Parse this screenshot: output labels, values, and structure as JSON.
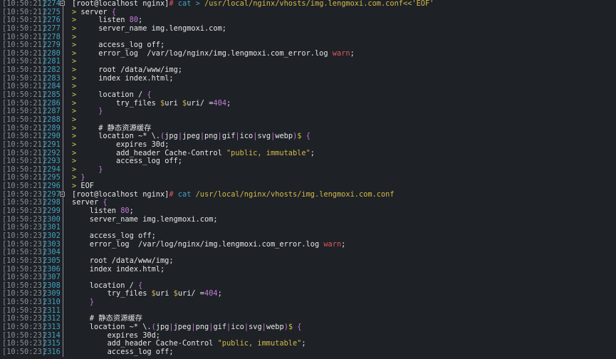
{
  "terminal": {
    "lines": [
      {
        "ts": "[10:50:21]",
        "ln": "2274",
        "fold": true,
        "parts": [
          {
            "t": "[root@localhost nginx]",
            "c": "pr"
          },
          {
            "t": "# ",
            "c": "hash"
          },
          {
            "t": "cat ",
            "c": "cmd"
          },
          {
            "t": "> ",
            "c": "cmd"
          },
          {
            "t": "/usr/local/nginx/vhosts/img.lengmoxi.com.conf<<'EOF'",
            "c": "path"
          }
        ]
      },
      {
        "ts": "[10:50:21]",
        "ln": "2275",
        "parts": [
          {
            "t": "> ",
            "c": "p"
          },
          {
            "t": "server ",
            "c": ""
          },
          {
            "t": "{",
            "c": "br"
          }
        ]
      },
      {
        "ts": "[10:50:21]",
        "ln": "2276",
        "parts": [
          {
            "t": ">     ",
            "c": "p"
          },
          {
            "t": "listen ",
            "c": ""
          },
          {
            "t": "80",
            "c": "num"
          },
          {
            "t": ";",
            "c": ""
          }
        ]
      },
      {
        "ts": "[10:50:21]",
        "ln": "2277",
        "parts": [
          {
            "t": ">     ",
            "c": "p"
          },
          {
            "t": "server_name img.lengmoxi.com;",
            "c": ""
          }
        ]
      },
      {
        "ts": "[10:50:21]",
        "ln": "2278",
        "parts": [
          {
            "t": ">",
            "c": "p"
          }
        ]
      },
      {
        "ts": "[10:50:21]",
        "ln": "2279",
        "parts": [
          {
            "t": ">     ",
            "c": "p"
          },
          {
            "t": "access_log off;",
            "c": ""
          }
        ]
      },
      {
        "ts": "[10:50:21]",
        "ln": "2280",
        "parts": [
          {
            "t": ">     ",
            "c": "p"
          },
          {
            "t": "error_log  /var/log/nginx/img.lengmoxi.com_error.log ",
            "c": ""
          },
          {
            "t": "warn",
            "c": "warn"
          },
          {
            "t": ";",
            "c": ""
          }
        ]
      },
      {
        "ts": "[10:50:21]",
        "ln": "2281",
        "parts": [
          {
            "t": ">",
            "c": "p"
          }
        ]
      },
      {
        "ts": "[10:50:21]",
        "ln": "2282",
        "parts": [
          {
            "t": ">     ",
            "c": "p"
          },
          {
            "t": "root /data/www/img;",
            "c": ""
          }
        ]
      },
      {
        "ts": "[10:50:21]",
        "ln": "2283",
        "parts": [
          {
            "t": ">     ",
            "c": "p"
          },
          {
            "t": "index index.html;",
            "c": ""
          }
        ]
      },
      {
        "ts": "[10:50:21]",
        "ln": "2284",
        "parts": [
          {
            "t": ">",
            "c": "p"
          }
        ]
      },
      {
        "ts": "[10:50:21]",
        "ln": "2285",
        "parts": [
          {
            "t": ">     ",
            "c": "p"
          },
          {
            "t": "location / ",
            "c": ""
          },
          {
            "t": "{",
            "c": "br"
          }
        ]
      },
      {
        "ts": "[10:50:21]",
        "ln": "2286",
        "parts": [
          {
            "t": ">         ",
            "c": "p"
          },
          {
            "t": "try_files ",
            "c": ""
          },
          {
            "t": "$",
            "c": "var"
          },
          {
            "t": "uri ",
            "c": ""
          },
          {
            "t": "$",
            "c": "var"
          },
          {
            "t": "uri/ =",
            "c": ""
          },
          {
            "t": "404",
            "c": "num"
          },
          {
            "t": ";",
            "c": ""
          }
        ]
      },
      {
        "ts": "[10:50:21]",
        "ln": "2287",
        "parts": [
          {
            "t": ">     ",
            "c": "p"
          },
          {
            "t": "}",
            "c": "br"
          }
        ]
      },
      {
        "ts": "[10:50:21]",
        "ln": "2288",
        "parts": [
          {
            "t": ">",
            "c": "p"
          }
        ]
      },
      {
        "ts": "[10:50:21]",
        "ln": "2289",
        "parts": [
          {
            "t": ">     ",
            "c": "p"
          },
          {
            "t": "# 静态资源缓存",
            "c": ""
          }
        ]
      },
      {
        "ts": "[10:50:21]",
        "ln": "2290",
        "parts": [
          {
            "t": ">     ",
            "c": "p"
          },
          {
            "t": "location ~* \\.",
            "c": ""
          },
          {
            "t": "(",
            "c": "sp"
          },
          {
            "t": "jpg",
            "c": ""
          },
          {
            "t": "|",
            "c": "sp"
          },
          {
            "t": "jpeg",
            "c": ""
          },
          {
            "t": "|",
            "c": "sp"
          },
          {
            "t": "png",
            "c": ""
          },
          {
            "t": "|",
            "c": "sp"
          },
          {
            "t": "gif",
            "c": ""
          },
          {
            "t": "|",
            "c": "sp"
          },
          {
            "t": "ico",
            "c": ""
          },
          {
            "t": "|",
            "c": "sp"
          },
          {
            "t": "svg",
            "c": ""
          },
          {
            "t": "|",
            "c": "sp"
          },
          {
            "t": "webp",
            "c": ""
          },
          {
            "t": ")",
            "c": "sp"
          },
          {
            "t": "$ ",
            "c": "var"
          },
          {
            "t": "{",
            "c": "br"
          }
        ]
      },
      {
        "ts": "[10:50:21]",
        "ln": "2291",
        "parts": [
          {
            "t": ">         ",
            "c": "p"
          },
          {
            "t": "expires 30d;",
            "c": ""
          }
        ]
      },
      {
        "ts": "[10:50:21]",
        "ln": "2292",
        "parts": [
          {
            "t": ">         ",
            "c": "p"
          },
          {
            "t": "add_header Cache-Control ",
            "c": ""
          },
          {
            "t": "\"public, immutable\"",
            "c": "str"
          },
          {
            "t": ";",
            "c": ""
          }
        ]
      },
      {
        "ts": "[10:50:21]",
        "ln": "2293",
        "parts": [
          {
            "t": ">         ",
            "c": "p"
          },
          {
            "t": "access_log off;",
            "c": ""
          }
        ]
      },
      {
        "ts": "[10:50:21]",
        "ln": "2294",
        "parts": [
          {
            "t": ">     ",
            "c": "p"
          },
          {
            "t": "}",
            "c": "br"
          }
        ]
      },
      {
        "ts": "[10:50:21]",
        "ln": "2295",
        "parts": [
          {
            "t": "> ",
            "c": "p"
          },
          {
            "t": "}",
            "c": "br"
          }
        ]
      },
      {
        "ts": "[10:50:21]",
        "ln": "2296",
        "parts": [
          {
            "t": "> ",
            "c": "p"
          },
          {
            "t": "EOF",
            "c": ""
          }
        ]
      },
      {
        "ts": "[10:50:23]",
        "ln": "2297",
        "fold": true,
        "parts": [
          {
            "t": "[root@localhost nginx]",
            "c": "pr"
          },
          {
            "t": "# ",
            "c": "hash"
          },
          {
            "t": "cat ",
            "c": "cmd"
          },
          {
            "t": "/usr/local/nginx/vhosts/img.lengmoxi.com.conf",
            "c": "path"
          }
        ]
      },
      {
        "ts": "[10:50:23]",
        "ln": "2298",
        "parts": [
          {
            "t": "server ",
            "c": ""
          },
          {
            "t": "{",
            "c": "br"
          }
        ]
      },
      {
        "ts": "[10:50:23]",
        "ln": "2299",
        "parts": [
          {
            "t": "    listen ",
            "c": ""
          },
          {
            "t": "80",
            "c": "num"
          },
          {
            "t": ";",
            "c": ""
          }
        ]
      },
      {
        "ts": "[10:50:23]",
        "ln": "2300",
        "parts": [
          {
            "t": "    server_name img.lengmoxi.com;",
            "c": ""
          }
        ]
      },
      {
        "ts": "[10:50:23]",
        "ln": "2301",
        "parts": []
      },
      {
        "ts": "[10:50:23]",
        "ln": "2302",
        "parts": [
          {
            "t": "    access_log off;",
            "c": ""
          }
        ]
      },
      {
        "ts": "[10:50:23]",
        "ln": "2303",
        "parts": [
          {
            "t": "    error_log  /var/log/nginx/img.lengmoxi.com_error.log ",
            "c": ""
          },
          {
            "t": "warn",
            "c": "warn"
          },
          {
            "t": ";",
            "c": ""
          }
        ]
      },
      {
        "ts": "[10:50:23]",
        "ln": "2304",
        "parts": []
      },
      {
        "ts": "[10:50:23]",
        "ln": "2305",
        "parts": [
          {
            "t": "    root /data/www/img;",
            "c": ""
          }
        ]
      },
      {
        "ts": "[10:50:23]",
        "ln": "2306",
        "parts": [
          {
            "t": "    index index.html;",
            "c": ""
          }
        ]
      },
      {
        "ts": "[10:50:23]",
        "ln": "2307",
        "parts": []
      },
      {
        "ts": "[10:50:23]",
        "ln": "2308",
        "parts": [
          {
            "t": "    location / ",
            "c": ""
          },
          {
            "t": "{",
            "c": "br"
          }
        ]
      },
      {
        "ts": "[10:50:23]",
        "ln": "2309",
        "parts": [
          {
            "t": "        try_files ",
            "c": ""
          },
          {
            "t": "$",
            "c": "var"
          },
          {
            "t": "uri ",
            "c": ""
          },
          {
            "t": "$",
            "c": "var"
          },
          {
            "t": "uri/ =",
            "c": ""
          },
          {
            "t": "404",
            "c": "num"
          },
          {
            "t": ";",
            "c": ""
          }
        ]
      },
      {
        "ts": "[10:50:23]",
        "ln": "2310",
        "parts": [
          {
            "t": "    ",
            "c": ""
          },
          {
            "t": "}",
            "c": "br"
          }
        ]
      },
      {
        "ts": "[10:50:23]",
        "ln": "2311",
        "parts": []
      },
      {
        "ts": "[10:50:23]",
        "ln": "2312",
        "parts": [
          {
            "t": "    # 静态资源缓存",
            "c": ""
          }
        ]
      },
      {
        "ts": "[10:50:23]",
        "ln": "2313",
        "parts": [
          {
            "t": "    location ~* \\.",
            "c": ""
          },
          {
            "t": "(",
            "c": "sp"
          },
          {
            "t": "jpg",
            "c": ""
          },
          {
            "t": "|",
            "c": "sp"
          },
          {
            "t": "jpeg",
            "c": ""
          },
          {
            "t": "|",
            "c": "sp"
          },
          {
            "t": "png",
            "c": ""
          },
          {
            "t": "|",
            "c": "sp"
          },
          {
            "t": "gif",
            "c": ""
          },
          {
            "t": "|",
            "c": "sp"
          },
          {
            "t": "ico",
            "c": ""
          },
          {
            "t": "|",
            "c": "sp"
          },
          {
            "t": "svg",
            "c": ""
          },
          {
            "t": "|",
            "c": "sp"
          },
          {
            "t": "webp",
            "c": ""
          },
          {
            "t": ")",
            "c": "sp"
          },
          {
            "t": "$ ",
            "c": "var"
          },
          {
            "t": "{",
            "c": "br"
          }
        ]
      },
      {
        "ts": "[10:50:23]",
        "ln": "2314",
        "parts": [
          {
            "t": "        expires 30d;",
            "c": ""
          }
        ]
      },
      {
        "ts": "[10:50:23]",
        "ln": "2315",
        "parts": [
          {
            "t": "        add_header Cache-Control ",
            "c": ""
          },
          {
            "t": "\"public, immutable\"",
            "c": "str"
          },
          {
            "t": ";",
            "c": ""
          }
        ]
      },
      {
        "ts": "[10:50:23]",
        "ln": "2316",
        "parts": [
          {
            "t": "        access_log off;",
            "c": ""
          }
        ]
      }
    ]
  }
}
